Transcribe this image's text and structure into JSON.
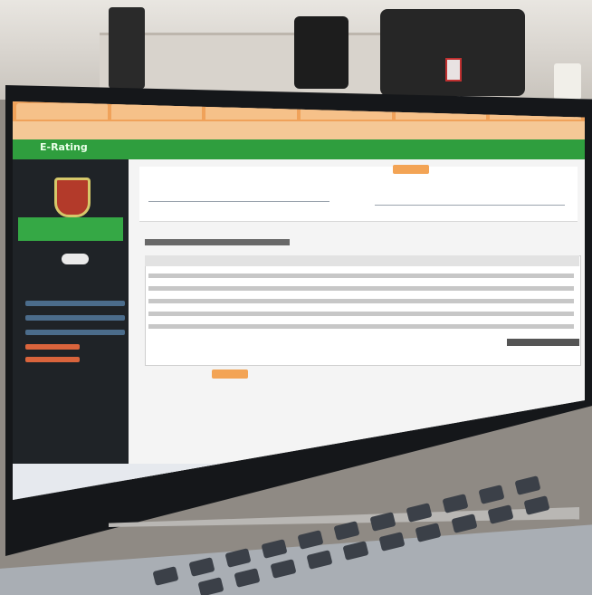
{
  "app": {
    "brand": "E-Rating"
  },
  "colors": {
    "header_green": "#2f9e3e",
    "sidebar_dark": "#1f2327",
    "browser_orange": "#f0a25a",
    "accent_orange": "#f3a455"
  },
  "icons": {
    "logo": "crest-shield-icon",
    "printer": "printer-icon"
  }
}
